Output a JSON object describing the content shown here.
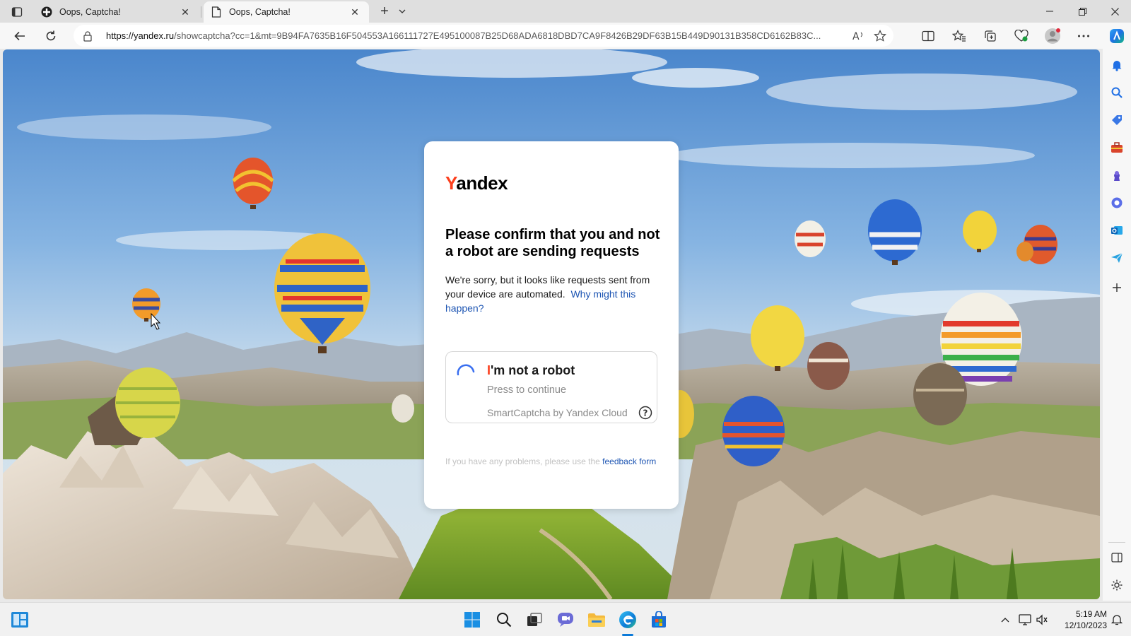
{
  "browser": {
    "tabs": [
      {
        "title": "Oops, Captcha!",
        "active": false
      },
      {
        "title": "Oops, Captcha!",
        "active": true
      }
    ],
    "address": {
      "host": "https://yandex.ru",
      "path": "/showcaptcha?cc=1&mt=9B94FA7635B16F504553A166111727E495100087B25D68ADA6818DBD7CA9F8426B29DF63B15B449D90131B358CD6162B83C..."
    }
  },
  "captcha": {
    "logo_first": "Y",
    "logo_rest": "andex",
    "heading": "Please confirm that you and not a robot are sending requests",
    "description": "We're sorry, but it looks like requests sent from your device are automated.",
    "why_link": "Why might this happen?",
    "checkbox": {
      "label_first": "I",
      "label_rest": "'m not a robot",
      "press": "Press to continue",
      "provider": "SmartCaptcha by Yandex Cloud"
    },
    "feedback_text": "If you have any problems, please use the",
    "feedback_link": "feedback form"
  },
  "taskbar": {
    "time": "5:19 AM",
    "date": "12/10/2023"
  },
  "colors": {
    "yandex_red": "#fc3f1d",
    "link_blue": "#1d55b3",
    "edge_accent": "#0c7ad8"
  },
  "icons": [
    "tab-actions-icon",
    "globe-favicon-icon",
    "page-favicon-icon",
    "close-icon",
    "plus-icon",
    "chevron-down-icon",
    "minimize-icon",
    "restore-icon",
    "back-icon",
    "refresh-icon",
    "lock-icon",
    "read-aloud-icon",
    "favorite-star-icon",
    "split-screen-icon",
    "favorites-icon",
    "collections-icon",
    "browser-essentials-icon",
    "profile-avatar-icon",
    "more-icon",
    "copilot-icon",
    "bell-icon",
    "search-icon",
    "shopping-tag-icon",
    "tools-icon",
    "games-icon",
    "microsoft365-icon",
    "outlook-icon",
    "drop-icon",
    "question-icon",
    "windows-start-icon",
    "task-view-icon",
    "chat-icon",
    "file-explorer-icon",
    "edge-icon",
    "store-icon",
    "widgets-icon",
    "network-icon",
    "volume-icon",
    "notification-icon",
    "settings-icon"
  ]
}
